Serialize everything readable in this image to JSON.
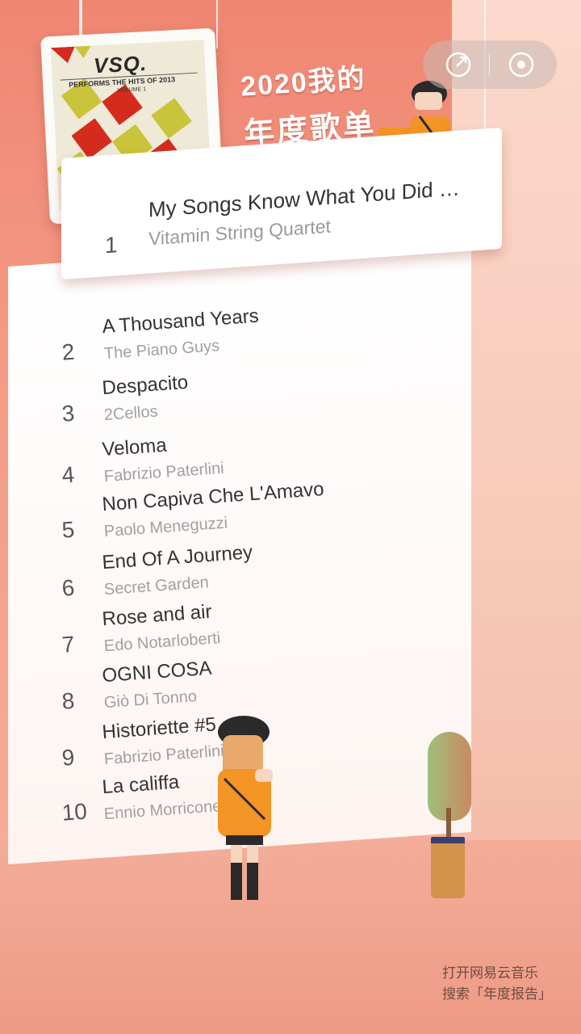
{
  "header": {
    "title_line1": "2020我的",
    "title_line2": "年度歌单"
  },
  "capsule": {
    "share_icon": "share-icon",
    "close_icon": "record-icon"
  },
  "album": {
    "logo": "VSQ.",
    "subtitle": "PERFORMS THE HITS OF 2013",
    "volume": "VOLUME 1"
  },
  "top_song": {
    "rank": "1",
    "title": "My Songs Know What You Did …",
    "artist": "Vitamin String Quartet"
  },
  "songs": [
    {
      "rank": "2",
      "title": "A Thousand Years",
      "artist": "The Piano Guys"
    },
    {
      "rank": "3",
      "title": "Despacito",
      "artist": "2Cellos"
    },
    {
      "rank": "4",
      "title": "Veloma",
      "artist": "Fabrizio Paterlini"
    },
    {
      "rank": "5",
      "title": "Non Capiva Che L'Amavo",
      "artist": "Paolo Meneguzzi"
    },
    {
      "rank": "6",
      "title": "End Of A Journey",
      "artist": "Secret Garden"
    },
    {
      "rank": "7",
      "title": "Rose and air",
      "artist": "Edo Notarloberti"
    },
    {
      "rank": "8",
      "title": "OGNI COSA",
      "artist": "Giò Di Tonno"
    },
    {
      "rank": "9",
      "title": "Historiette #5",
      "artist": "Fabrizio Paterlini"
    },
    {
      "rank": "10",
      "title": "La califfa",
      "artist": "Ennio Morricone"
    }
  ],
  "footer": {
    "line1": "打开网易云音乐",
    "line2": "搜索「年度报告」"
  },
  "colors": {
    "accent": "#ef8672",
    "card": "#ffffff",
    "title_text": "#333333",
    "artist_text": "#a0a0a0"
  }
}
